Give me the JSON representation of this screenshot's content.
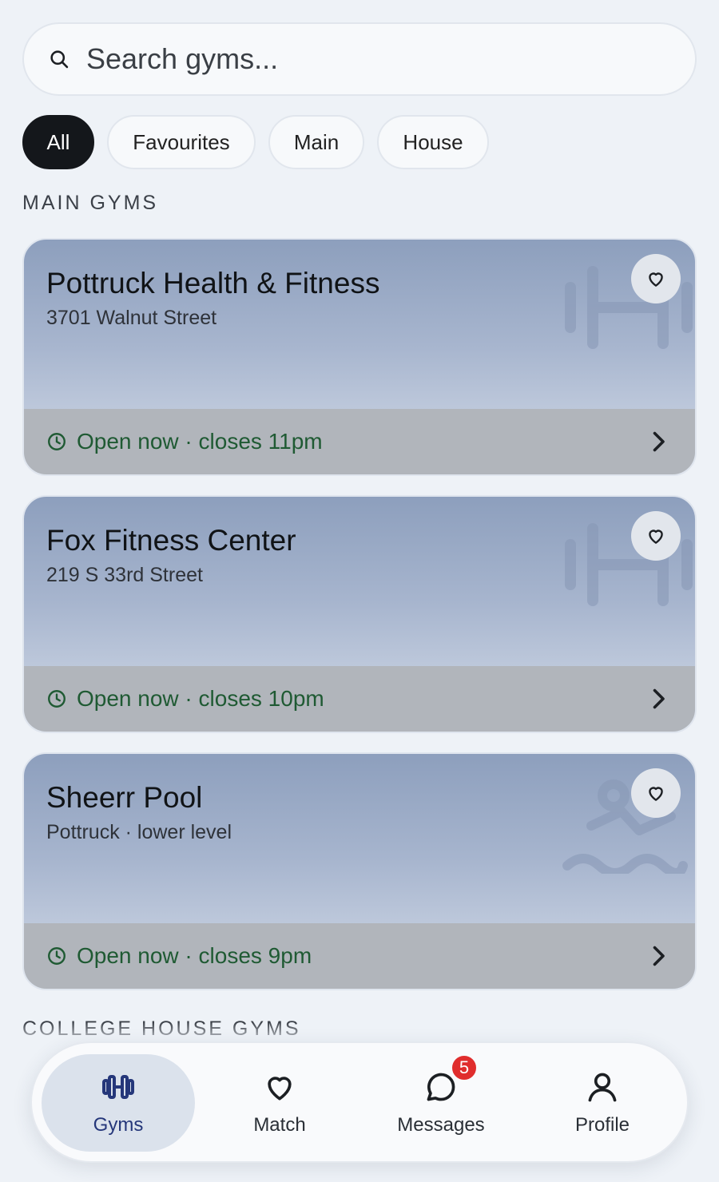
{
  "search": {
    "placeholder": "Search gyms..."
  },
  "filters": [
    "All",
    "Favourites",
    "Main",
    "House"
  ],
  "sections": {
    "main": "MAIN GYMS",
    "college": "COLLEGE HOUSE GYMS"
  },
  "gyms": [
    {
      "name": "Pottruck Health & Fitness",
      "address": "3701 Walnut Street",
      "status": "Open now · closes 11pm",
      "icon": "dumbbell-icon"
    },
    {
      "name": "Fox Fitness Center",
      "address": "219 S 33rd Street",
      "status": "Open now · closes 10pm",
      "icon": "dumbbell-icon"
    },
    {
      "name": "Sheerr Pool",
      "address": "Pottruck · lower level",
      "status": "Open now · closes 9pm",
      "icon": "swimmer-icon"
    }
  ],
  "nav": [
    {
      "label": "Gyms",
      "icon": "dumbbell-icon",
      "active": true
    },
    {
      "label": "Match",
      "icon": "heart-icon"
    },
    {
      "label": "Messages",
      "icon": "chat-icon",
      "badge": "5"
    },
    {
      "label": "Profile",
      "icon": "person-icon"
    }
  ],
  "colors": {
    "active_chip": "#14171b",
    "status_green": "#1f5a33",
    "badge_red": "#e02d2d",
    "nav_active": "#25377a"
  }
}
